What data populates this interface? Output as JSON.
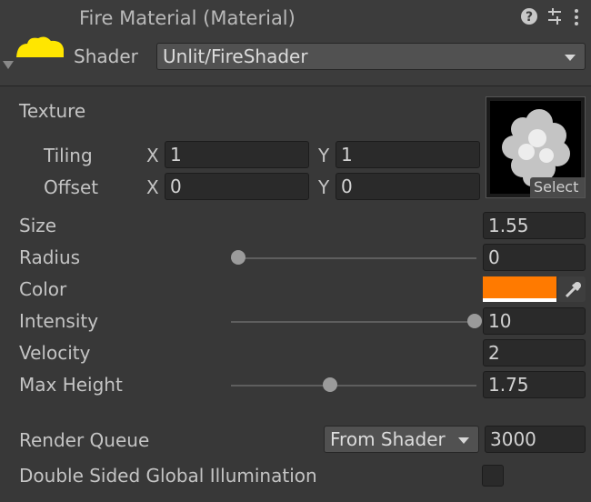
{
  "header": {
    "title": "Fire Material (Material)",
    "shader_label": "Shader",
    "shader_value": "Unlit/FireShader",
    "icons": [
      "help-icon",
      "preset-sliders-icon",
      "more-menu-icon"
    ]
  },
  "texture": {
    "label": "Texture",
    "tiling_label": "Tiling",
    "offset_label": "Offset",
    "x_label": "X",
    "y_label": "Y",
    "tiling_x": "1",
    "tiling_y": "1",
    "offset_x": "0",
    "offset_y": "0",
    "select_label": "Select"
  },
  "properties": {
    "size_label": "Size",
    "size_value": "1.55",
    "radius_label": "Radius",
    "radius_value": "0",
    "radius_fraction": 0.0,
    "color_label": "Color",
    "color_value": "#ff7a00",
    "intensity_label": "Intensity",
    "intensity_value": "10",
    "intensity_fraction": 1.0,
    "velocity_label": "Velocity",
    "velocity_value": "2",
    "maxheight_label": "Max Height",
    "maxheight_value": "1.75",
    "maxheight_fraction": 0.39
  },
  "render_queue": {
    "label": "Render Queue",
    "mode": "From Shader",
    "value": "3000"
  },
  "gi": {
    "label": "Double Sided Global Illumination",
    "checked": false
  },
  "colors": {
    "accent_yellow": "#ffe600",
    "background": "#383838"
  }
}
